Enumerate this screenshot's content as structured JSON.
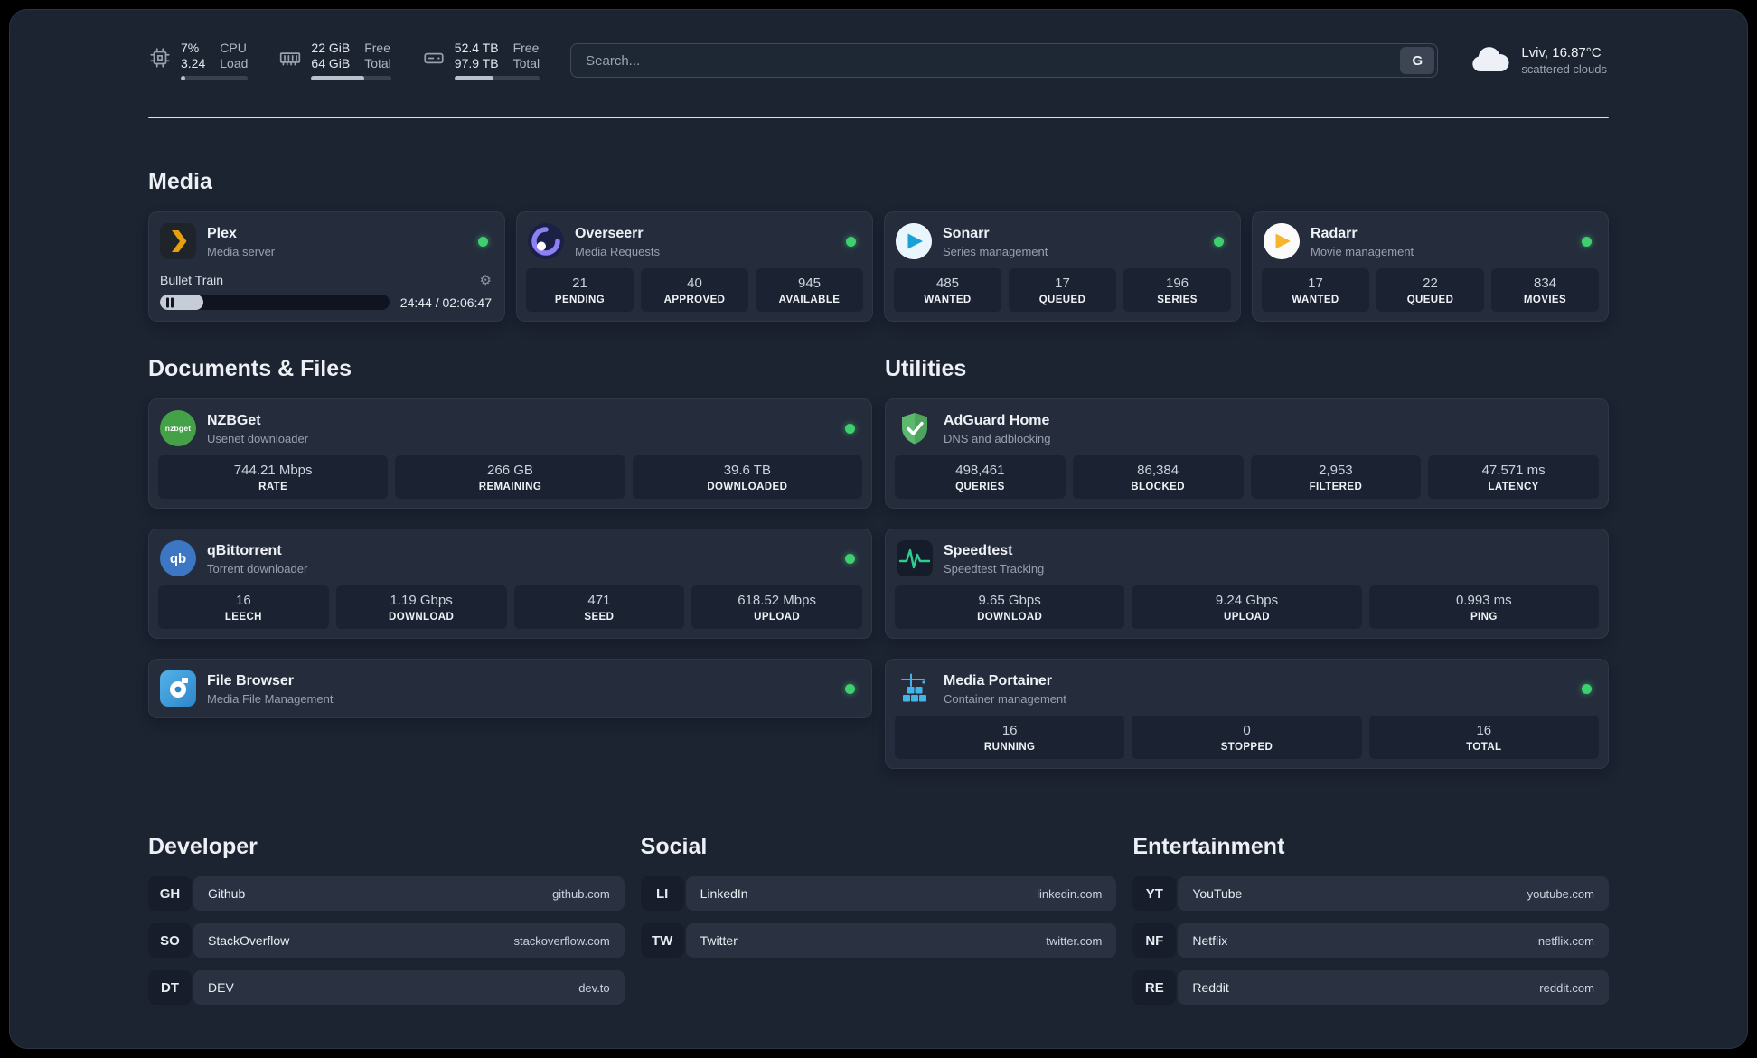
{
  "topbar": {
    "resources": [
      {
        "values": [
          "7%",
          "3.24"
        ],
        "labels": [
          "CPU",
          "Load"
        ],
        "percent": 7
      },
      {
        "values": [
          "22 GiB",
          "64 GiB"
        ],
        "labels": [
          "Free",
          "Total"
        ],
        "percent": 66
      },
      {
        "values": [
          "52.4 TB",
          "97.9 TB"
        ],
        "labels": [
          "Free",
          "Total"
        ],
        "percent": 46
      }
    ],
    "search": {
      "placeholder": "Search...",
      "provider_button": "G"
    },
    "weather": {
      "location": "Lviv, 16.87°C",
      "condition": "scattered clouds"
    }
  },
  "sections": {
    "media": {
      "title": "Media",
      "plex": {
        "name": "Plex",
        "desc": "Media server",
        "status": "online",
        "now_playing": {
          "title": "Bullet Train",
          "time": "24:44 / 02:06:47",
          "progress_percent": 19
        }
      },
      "overseerr": {
        "name": "Overseerr",
        "desc": "Media Requests",
        "status": "online",
        "stats": [
          {
            "value": "21",
            "label": "PENDING"
          },
          {
            "value": "40",
            "label": "APPROVED"
          },
          {
            "value": "945",
            "label": "AVAILABLE"
          }
        ]
      },
      "sonarr": {
        "name": "Sonarr",
        "desc": "Series management",
        "status": "online",
        "stats": [
          {
            "value": "485",
            "label": "WANTED"
          },
          {
            "value": "17",
            "label": "QUEUED"
          },
          {
            "value": "196",
            "label": "SERIES"
          }
        ]
      },
      "radarr": {
        "name": "Radarr",
        "desc": "Movie management",
        "status": "online",
        "stats": [
          {
            "value": "17",
            "label": "WANTED"
          },
          {
            "value": "22",
            "label": "QUEUED"
          },
          {
            "value": "834",
            "label": "MOVIES"
          }
        ]
      }
    },
    "documents": {
      "title": "Documents & Files",
      "nzbget": {
        "name": "NZBGet",
        "desc": "Usenet downloader",
        "status": "online",
        "stats": [
          {
            "value": "744.21 Mbps",
            "label": "RATE"
          },
          {
            "value": "266 GB",
            "label": "REMAINING"
          },
          {
            "value": "39.6 TB",
            "label": "DOWNLOADED"
          }
        ]
      },
      "qbittorrent": {
        "name": "qBittorrent",
        "desc": "Torrent downloader",
        "status": "online",
        "stats": [
          {
            "value": "16",
            "label": "LEECH"
          },
          {
            "value": "1.19 Gbps",
            "label": "DOWNLOAD"
          },
          {
            "value": "471",
            "label": "SEED"
          },
          {
            "value": "618.52 Mbps",
            "label": "UPLOAD"
          }
        ]
      },
      "filebrowser": {
        "name": "File Browser",
        "desc": "Media File Management",
        "status": "online"
      }
    },
    "utilities": {
      "title": "Utilities",
      "adguard": {
        "name": "AdGuard Home",
        "desc": "DNS and adblocking",
        "stats": [
          {
            "value": "498,461",
            "label": "QUERIES"
          },
          {
            "value": "86,384",
            "label": "BLOCKED"
          },
          {
            "value": "2,953",
            "label": "FILTERED"
          },
          {
            "value": "47.571 ms",
            "label": "LATENCY"
          }
        ]
      },
      "speedtest": {
        "name": "Speedtest",
        "desc": "Speedtest Tracking",
        "stats": [
          {
            "value": "9.65 Gbps",
            "label": "DOWNLOAD"
          },
          {
            "value": "9.24 Gbps",
            "label": "UPLOAD"
          },
          {
            "value": "0.993 ms",
            "label": "PING"
          }
        ]
      },
      "portainer": {
        "name": "Media Portainer",
        "desc": "Container management",
        "status": "online",
        "stats": [
          {
            "value": "16",
            "label": "RUNNING"
          },
          {
            "value": "0",
            "label": "STOPPED"
          },
          {
            "value": "16",
            "label": "TOTAL"
          }
        ]
      }
    },
    "bookmarks": [
      {
        "title": "Developer",
        "items": [
          {
            "abbr": "GH",
            "name": "Github",
            "url": "github.com"
          },
          {
            "abbr": "SO",
            "name": "StackOverflow",
            "url": "stackoverflow.com"
          },
          {
            "abbr": "DT",
            "name": "DEV",
            "url": "dev.to"
          }
        ]
      },
      {
        "title": "Social",
        "items": [
          {
            "abbr": "LI",
            "name": "LinkedIn",
            "url": "linkedin.com"
          },
          {
            "abbr": "TW",
            "name": "Twitter",
            "url": "twitter.com"
          }
        ]
      },
      {
        "title": "Entertainment",
        "items": [
          {
            "abbr": "YT",
            "name": "YouTube",
            "url": "youtube.com"
          },
          {
            "abbr": "NF",
            "name": "Netflix",
            "url": "netflix.com"
          },
          {
            "abbr": "RE",
            "name": "Reddit",
            "url": "reddit.com"
          }
        ]
      }
    ]
  }
}
